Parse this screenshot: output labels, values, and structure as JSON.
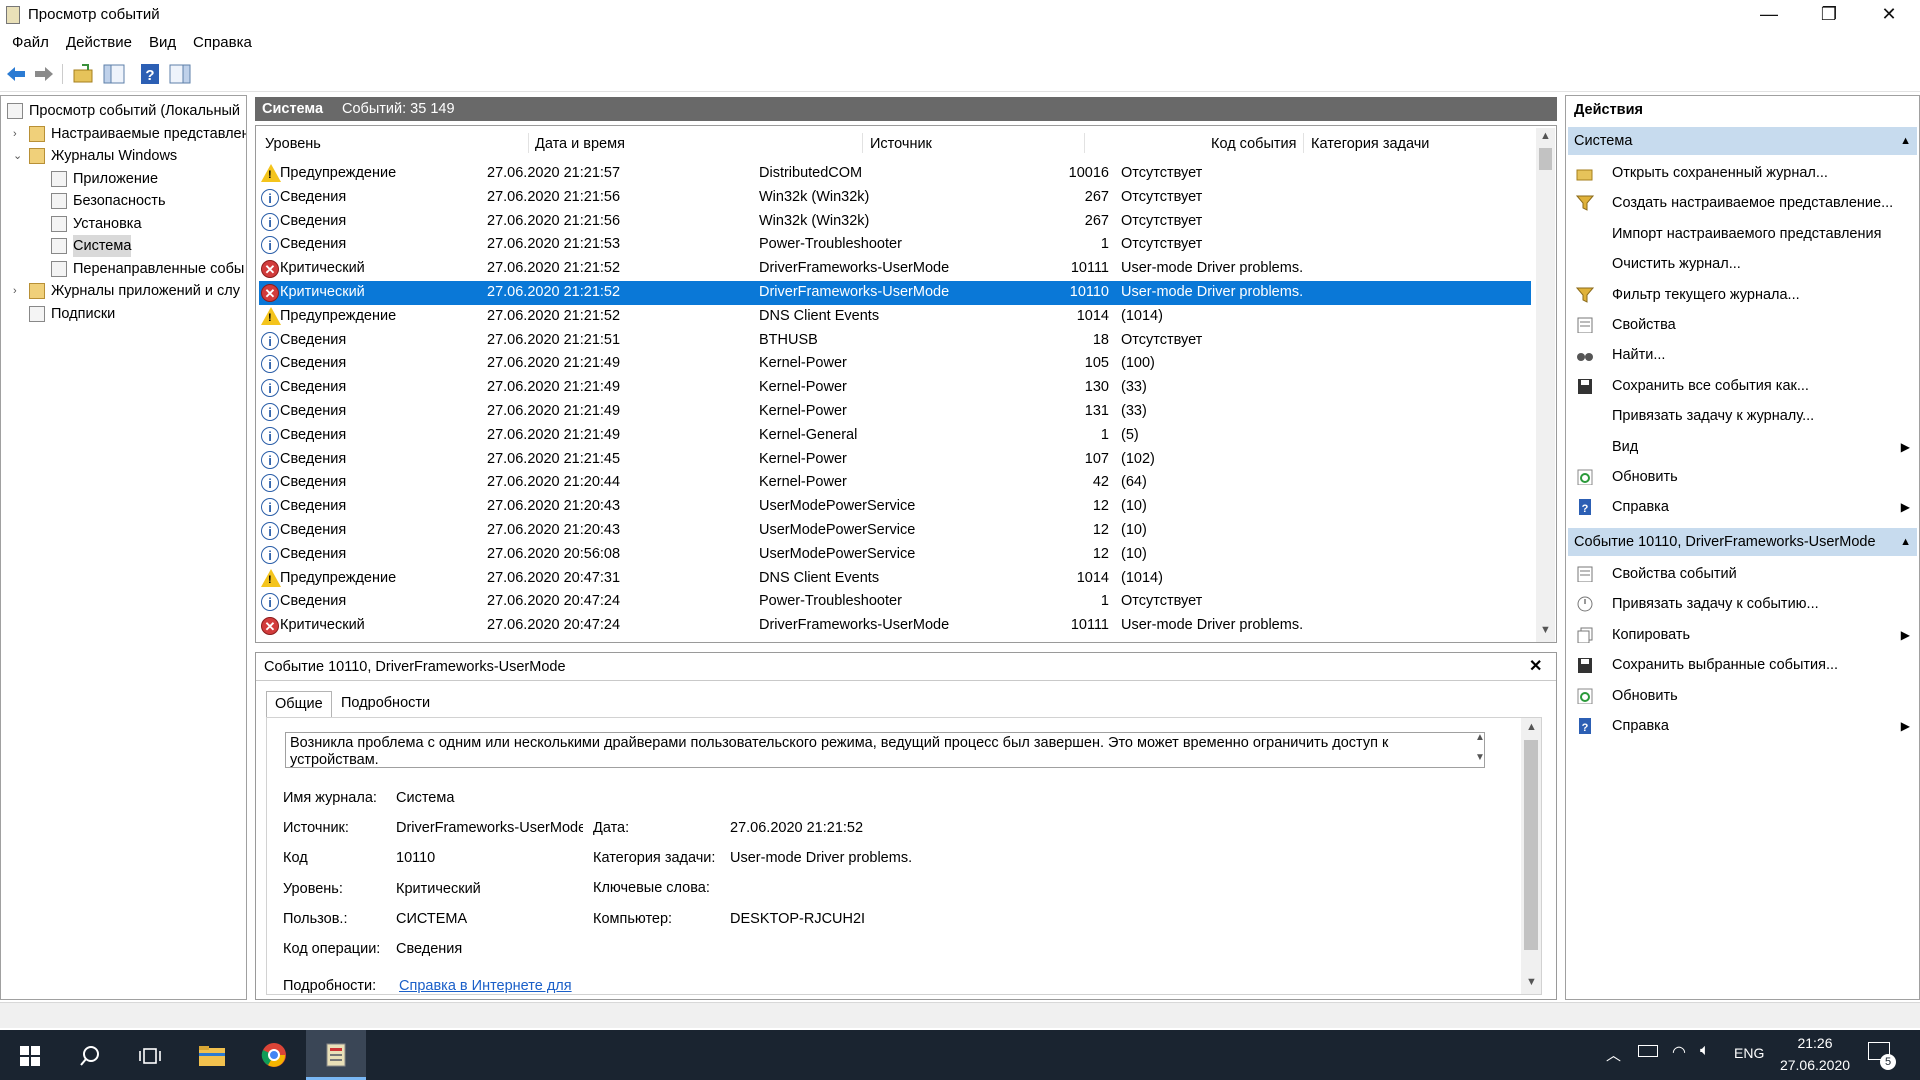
{
  "window": {
    "title": "Просмотр событий"
  },
  "menu": [
    "Файл",
    "Действие",
    "Вид",
    "Справка"
  ],
  "tree": [
    {
      "label": "Просмотр событий (Локальный",
      "level": 0,
      "arrow": "",
      "icon": "event-viewer-icon"
    },
    {
      "label": "Настраиваемые представлен",
      "level": 1,
      "arrow": "›",
      "icon": "folder-icon"
    },
    {
      "label": "Журналы Windows",
      "level": 1,
      "arrow": "⌄",
      "icon": "folder-icon"
    },
    {
      "label": "Приложение",
      "level": 2,
      "arrow": "",
      "icon": "log-icon"
    },
    {
      "label": "Безопасность",
      "level": 2,
      "arrow": "",
      "icon": "log-icon"
    },
    {
      "label": "Установка",
      "level": 2,
      "arrow": "",
      "icon": "log-icon"
    },
    {
      "label": "Система",
      "level": 2,
      "arrow": "",
      "icon": "log-icon",
      "selected": true
    },
    {
      "label": "Перенаправленные собы",
      "level": 2,
      "arrow": "",
      "icon": "log-icon"
    },
    {
      "label": "Журналы приложений и слу",
      "level": 1,
      "arrow": "›",
      "icon": "folder-icon"
    },
    {
      "label": "Подписки",
      "level": 1,
      "arrow": "",
      "icon": "log-icon"
    }
  ],
  "center": {
    "log_name": "Система",
    "count_text": "Событий: 35 149"
  },
  "columns": [
    "Уровень",
    "Дата и время",
    "Источник",
    "Код события",
    "Категория задачи"
  ],
  "events": [
    {
      "level": "Предупреждение",
      "type": "warn",
      "date": "27.06.2020 21:21:57",
      "source": "DistributedCOM",
      "code": "10016",
      "category": "Отсутствует"
    },
    {
      "level": "Сведения",
      "type": "info",
      "date": "27.06.2020 21:21:56",
      "source": "Win32k (Win32k)",
      "code": "267",
      "category": "Отсутствует"
    },
    {
      "level": "Сведения",
      "type": "info",
      "date": "27.06.2020 21:21:56",
      "source": "Win32k (Win32k)",
      "code": "267",
      "category": "Отсутствует"
    },
    {
      "level": "Сведения",
      "type": "info",
      "date": "27.06.2020 21:21:53",
      "source": "Power-Troubleshooter",
      "code": "1",
      "category": "Отсутствует"
    },
    {
      "level": "Критический",
      "type": "crit",
      "date": "27.06.2020 21:21:52",
      "source": "DriverFrameworks-UserMode",
      "code": "10111",
      "category": "User-mode Driver problems."
    },
    {
      "level": "Критический",
      "type": "crit",
      "date": "27.06.2020 21:21:52",
      "source": "DriverFrameworks-UserMode",
      "code": "10110",
      "category": "User-mode Driver problems.",
      "selected": true
    },
    {
      "level": "Предупреждение",
      "type": "warn",
      "date": "27.06.2020 21:21:52",
      "source": "DNS Client Events",
      "code": "1014",
      "category": "(1014)"
    },
    {
      "level": "Сведения",
      "type": "info",
      "date": "27.06.2020 21:21:51",
      "source": "BTHUSB",
      "code": "18",
      "category": "Отсутствует"
    },
    {
      "level": "Сведения",
      "type": "info",
      "date": "27.06.2020 21:21:49",
      "source": "Kernel-Power",
      "code": "105",
      "category": "(100)"
    },
    {
      "level": "Сведения",
      "type": "info",
      "date": "27.06.2020 21:21:49",
      "source": "Kernel-Power",
      "code": "130",
      "category": "(33)"
    },
    {
      "level": "Сведения",
      "type": "info",
      "date": "27.06.2020 21:21:49",
      "source": "Kernel-Power",
      "code": "131",
      "category": "(33)"
    },
    {
      "level": "Сведения",
      "type": "info",
      "date": "27.06.2020 21:21:49",
      "source": "Kernel-General",
      "code": "1",
      "category": "(5)"
    },
    {
      "level": "Сведения",
      "type": "info",
      "date": "27.06.2020 21:21:45",
      "source": "Kernel-Power",
      "code": "107",
      "category": "(102)"
    },
    {
      "level": "Сведения",
      "type": "info",
      "date": "27.06.2020 21:20:44",
      "source": "Kernel-Power",
      "code": "42",
      "category": "(64)"
    },
    {
      "level": "Сведения",
      "type": "info",
      "date": "27.06.2020 21:20:43",
      "source": "UserModePowerService",
      "code": "12",
      "category": "(10)"
    },
    {
      "level": "Сведения",
      "type": "info",
      "date": "27.06.2020 21:20:43",
      "source": "UserModePowerService",
      "code": "12",
      "category": "(10)"
    },
    {
      "level": "Сведения",
      "type": "info",
      "date": "27.06.2020 20:56:08",
      "source": "UserModePowerService",
      "code": "12",
      "category": "(10)"
    },
    {
      "level": "Предупреждение",
      "type": "warn",
      "date": "27.06.2020 20:47:31",
      "source": "DNS Client Events",
      "code": "1014",
      "category": "(1014)"
    },
    {
      "level": "Сведения",
      "type": "info",
      "date": "27.06.2020 20:47:24",
      "source": "Power-Troubleshooter",
      "code": "1",
      "category": "Отсутствует"
    },
    {
      "level": "Критический",
      "type": "crit",
      "date": "27.06.2020 20:47:24",
      "source": "DriverFrameworks-UserMode",
      "code": "10111",
      "category": "User-mode Driver problems."
    }
  ],
  "detail": {
    "header": "Событие 10110, DriverFrameworks-UserMode",
    "tabs": [
      "Общие",
      "Подробности"
    ],
    "description": "Возникла проблема с одним или несколькими драйверами пользовательского режима, ведущий процесс был завершен. Это может временно ограничить доступ к устройствам.",
    "fields_left": [
      {
        "label": "Имя журнала:",
        "value": "Система"
      },
      {
        "label": "Источник:",
        "value": "DriverFrameworks-UserMode"
      },
      {
        "label": "Код",
        "value": "10110"
      },
      {
        "label": "Уровень:",
        "value": "Критический"
      },
      {
        "label": "Пользов.:",
        "value": "СИСТЕМА"
      },
      {
        "label": "Код операции:",
        "value": "Сведения"
      }
    ],
    "fields_right": [
      {
        "label": "Дата:",
        "value": "27.06.2020 21:21:52"
      },
      {
        "label": "Категория задачи:",
        "value": "User-mode Driver problems."
      },
      {
        "label": "Ключевые слова:",
        "value": ""
      },
      {
        "label": "Компьютер:",
        "value": "DESKTOP-RJCUH2I"
      }
    ],
    "more_label": "Подробности:",
    "more_link": "Справка в Интернете для"
  },
  "actions": {
    "title": "Действия",
    "section1": "Система",
    "items1": [
      {
        "label": "Открыть сохраненный журнал...",
        "icon": "open-folder-icon"
      },
      {
        "label": "Создать настраиваемое представление...",
        "icon": "filter-icon"
      },
      {
        "label": "Импорт настраиваемого представления",
        "icon": ""
      },
      {
        "label": "Очистить журнал...",
        "icon": ""
      },
      {
        "label": "Фильтр текущего журнала...",
        "icon": "filter-icon"
      },
      {
        "label": "Свойства",
        "icon": "properties-icon"
      },
      {
        "label": "Найти...",
        "icon": "binoculars-icon"
      },
      {
        "label": "Сохранить все события как...",
        "icon": "save-icon"
      },
      {
        "label": "Привязать задачу к журналу...",
        "icon": ""
      },
      {
        "label": "Вид",
        "icon": "",
        "sub": true
      },
      {
        "label": "Обновить",
        "icon": "refresh-icon"
      },
      {
        "label": "Справка",
        "icon": "help-icon",
        "sub": true
      }
    ],
    "section2": "Событие 10110, DriverFrameworks-UserMode",
    "items2": [
      {
        "label": "Свойства событий",
        "icon": "properties-icon"
      },
      {
        "label": "Привязать задачу к событию...",
        "icon": "task-icon"
      },
      {
        "label": "Копировать",
        "icon": "copy-icon",
        "sub": true
      },
      {
        "label": "Сохранить выбранные события...",
        "icon": "save-icon"
      },
      {
        "label": "Обновить",
        "icon": "refresh-icon"
      },
      {
        "label": "Справка",
        "icon": "help-icon",
        "sub": true
      }
    ]
  },
  "taskbar": {
    "lang": "ENG",
    "time": "21:26",
    "date": "27.06.2020",
    "notif_count": "5"
  }
}
